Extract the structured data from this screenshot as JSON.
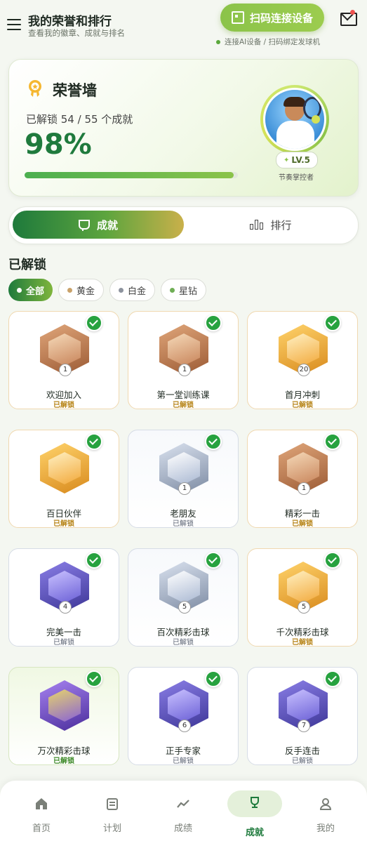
{
  "header": {
    "title": "我的荣誉和排行",
    "subtitle": "查看我的徽章、成就与排名",
    "scan_button": "扫码连接设备",
    "connect_hint": "连接AI设备 / 扫码绑定发球机"
  },
  "hero": {
    "title": "荣誉墙",
    "unlocked_text": "已解锁 54 / 55 个成就",
    "percent": "98%",
    "progress": 0.98,
    "level": "LV.5",
    "level_title": "节奏掌控者"
  },
  "tabs": {
    "achievements": "成就",
    "ranking": "排行"
  },
  "section": {
    "title": "已解锁"
  },
  "filters": [
    {
      "label": "全部",
      "color": "#ffffff"
    },
    {
      "label": "黄金",
      "color": "#c9a26a"
    },
    {
      "label": "白金",
      "color": "#8d939e"
    },
    {
      "label": "星钻",
      "color": "#6fae55"
    }
  ],
  "achievements": [
    {
      "name": "欢迎加入",
      "status": "已解锁",
      "tier": "bronze",
      "num": "1"
    },
    {
      "name": "第一堂训练课",
      "status": "已解锁",
      "tier": "bronze",
      "num": "1"
    },
    {
      "name": "首月冲刺",
      "status": "已解锁",
      "tier": "gold",
      "num": "20"
    },
    {
      "name": "百日伙伴",
      "status": "已解锁",
      "tier": "gold",
      "num": ""
    },
    {
      "name": "老朋友",
      "status": "已解锁",
      "tier": "silver",
      "num": "1"
    },
    {
      "name": "精彩一击",
      "status": "已解锁",
      "tier": "bronze",
      "num": "1"
    },
    {
      "name": "完美一击",
      "status": "已解锁",
      "tier": "purple",
      "num": "4"
    },
    {
      "name": "百次精彩击球",
      "status": "已解锁",
      "tier": "silver",
      "num": "5"
    },
    {
      "name": "千次精彩击球",
      "status": "已解锁",
      "tier": "gold",
      "num": "5"
    },
    {
      "name": "万次精彩击球",
      "status": "已解锁",
      "tier": "green",
      "num": ""
    },
    {
      "name": "正手专家",
      "status": "已解锁",
      "tier": "purple",
      "num": "6"
    },
    {
      "name": "反手连击",
      "status": "已解锁",
      "tier": "purple",
      "num": "7"
    }
  ],
  "nav": [
    {
      "label": "首页"
    },
    {
      "label": "计划"
    },
    {
      "label": "成绩"
    },
    {
      "label": "成就"
    },
    {
      "label": "我的"
    }
  ]
}
